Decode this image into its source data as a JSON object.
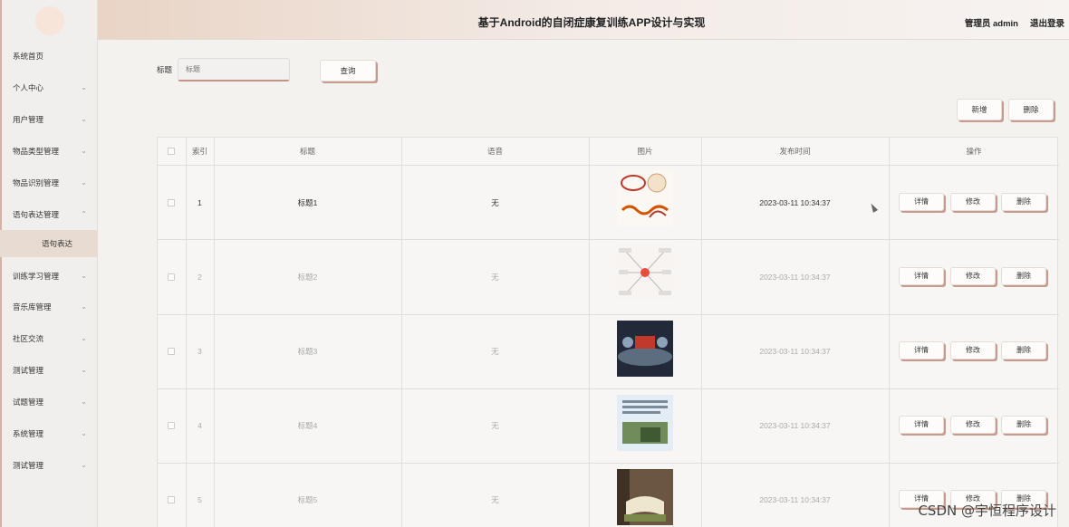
{
  "header": {
    "title": "基于Android的自闭症康复训练APP设计与实现",
    "user": "管理员 admin",
    "logout": "退出登录"
  },
  "sidebar": {
    "items": [
      {
        "label": "系统首页",
        "chevron": ""
      },
      {
        "label": "个人中心",
        "chevron": "⌄"
      },
      {
        "label": "用户管理",
        "chevron": "⌄"
      },
      {
        "label": "物品类型管理",
        "chevron": "⌄"
      },
      {
        "label": "物品识别管理",
        "chevron": "⌄"
      },
      {
        "label": "语句表达管理",
        "chevron": "⌃"
      },
      {
        "label": "训练学习管理",
        "chevron": "⌄"
      },
      {
        "label": "音乐库管理",
        "chevron": "⌄"
      },
      {
        "label": "社区交流",
        "chevron": "⌄"
      },
      {
        "label": "测试管理",
        "chevron": "⌄"
      },
      {
        "label": "试题管理",
        "chevron": "⌄"
      },
      {
        "label": "系统管理",
        "chevron": "⌄"
      },
      {
        "label": "测试管理",
        "chevron": "⌄"
      }
    ],
    "sub_item": "语句表达"
  },
  "search": {
    "label": "标题",
    "placeholder": "标题",
    "button": "查询"
  },
  "toolbar": {
    "add": "新增",
    "delete": "删除"
  },
  "table": {
    "columns": [
      "索引",
      "标题",
      "语音",
      "图片",
      "发布时间",
      "操作"
    ],
    "rows": [
      {
        "index": "1",
        "title": "标题1",
        "voice": "无",
        "image": "heart-banner-image",
        "time": "2023-03-11 10:34:37"
      },
      {
        "index": "2",
        "title": "标题2",
        "voice": "无",
        "image": "mindmap-image",
        "time": "2023-03-11 10:34:37"
      },
      {
        "index": "3",
        "title": "标题3",
        "voice": "无",
        "image": "dark-logo-image",
        "time": "2023-03-11 10:34:37"
      },
      {
        "index": "4",
        "title": "标题4",
        "voice": "无",
        "image": "poster-image",
        "time": "2023-03-11 10:34:37"
      },
      {
        "index": "5",
        "title": "标题5",
        "voice": "无",
        "image": "book-image",
        "time": "2023-03-11 10:34:37"
      }
    ],
    "actions": {
      "detail": "详情",
      "edit": "修改",
      "delete": "删除"
    }
  },
  "watermark": "CSDN @宇恒程序设计",
  "colors": {
    "accent": "#c69b8d",
    "header_start": "#e9d4c6",
    "sidebar_bg": "#f1efee"
  }
}
